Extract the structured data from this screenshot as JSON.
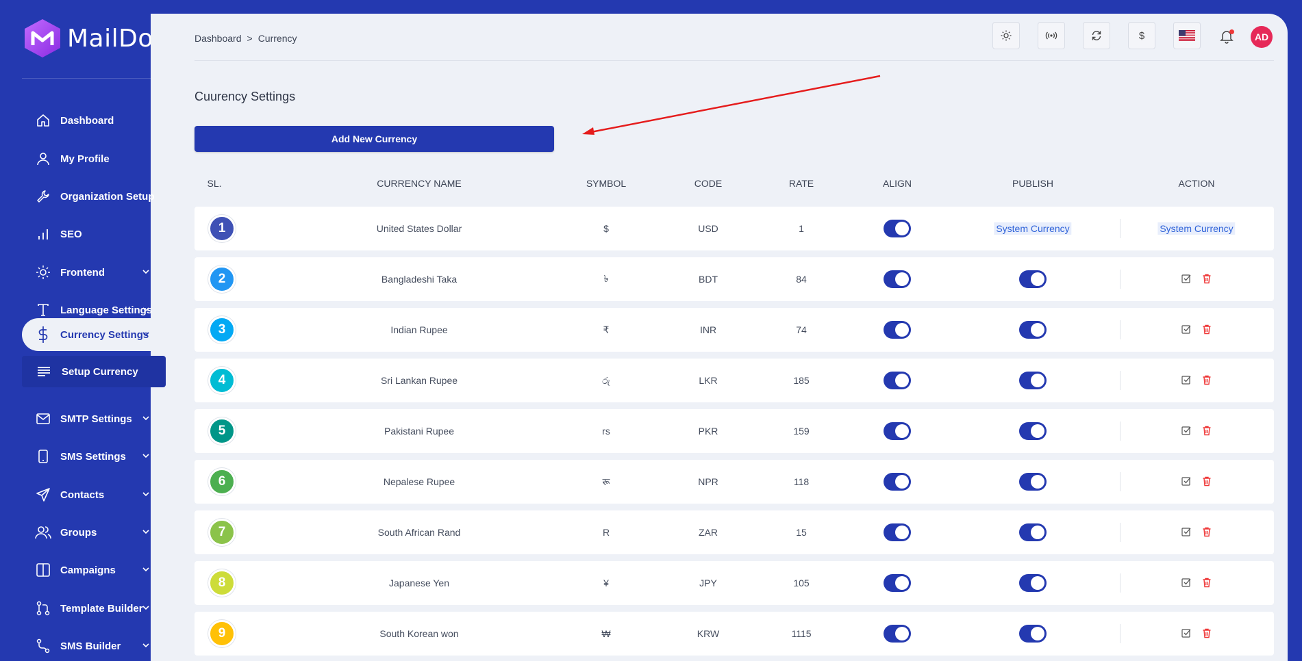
{
  "brand": {
    "name": "MailDoll"
  },
  "sidebar": {
    "items": [
      {
        "label": "Dashboard",
        "icon": "home-icon",
        "has_chevron": false
      },
      {
        "label": "My Profile",
        "icon": "user-icon",
        "has_chevron": false
      },
      {
        "label": "Organization Setup",
        "icon": "wrench-icon",
        "has_chevron": false
      },
      {
        "label": "SEO",
        "icon": "bar-chart-icon",
        "has_chevron": false
      },
      {
        "label": "Frontend",
        "icon": "sun-icon",
        "has_chevron": true
      },
      {
        "label": "Language Settings",
        "icon": "text-icon",
        "has_chevron": true
      },
      {
        "label": "Currency Settings",
        "icon": "dollar-icon",
        "has_chevron": true,
        "active": true
      },
      {
        "label": "SMTP Settings",
        "icon": "mail-icon",
        "has_chevron": true
      },
      {
        "label": "SMS Settings",
        "icon": "phone-icon",
        "has_chevron": true
      },
      {
        "label": "Contacts",
        "icon": "send-icon",
        "has_chevron": true
      },
      {
        "label": "Groups",
        "icon": "users-icon",
        "has_chevron": true
      },
      {
        "label": "Campaigns",
        "icon": "columns-icon",
        "has_chevron": true
      },
      {
        "label": "Template Builder",
        "icon": "git-pull-icon",
        "has_chevron": true
      },
      {
        "label": "SMS Builder",
        "icon": "route-icon",
        "has_chevron": true
      }
    ],
    "sub_item": {
      "label": "Setup Currency",
      "icon": "list-icon"
    }
  },
  "breadcrumb": {
    "root": "Dashboard",
    "separator": ">",
    "current": "Currency"
  },
  "topbar": {
    "buttons": [
      "sun-icon",
      "broadcast-icon",
      "refresh-icon",
      "dollar-icon",
      "us-flag-icon"
    ],
    "currency_symbol": "$",
    "avatar_initials": "AD"
  },
  "page": {
    "title": "Cuurency Settings",
    "add_button": "Add New Currency"
  },
  "table": {
    "headers": {
      "sl": "SL.",
      "name": "CURRENCY NAME",
      "symbol": "SYMBOL",
      "code": "CODE",
      "rate": "RATE",
      "align": "ALIGN",
      "publish": "PUBLISH",
      "action": "ACTION"
    },
    "system_currency_label": "System Currency",
    "rows": [
      {
        "sl": "1",
        "name": "United States Dollar",
        "symbol": "$",
        "code": "USD",
        "rate": "1",
        "align_on": true,
        "system": true,
        "badge_color": "#3f51b5"
      },
      {
        "sl": "2",
        "name": "Bangladeshi Taka",
        "symbol": "৳",
        "code": "BDT",
        "rate": "84",
        "align_on": true,
        "publish_on": true,
        "badge_color": "#2196f3"
      },
      {
        "sl": "3",
        "name": "Indian Rupee",
        "symbol": "₹",
        "code": "INR",
        "rate": "74",
        "align_on": true,
        "publish_on": true,
        "badge_color": "#03a9f4"
      },
      {
        "sl": "4",
        "name": "Sri Lankan Rupee",
        "symbol": "රු",
        "code": "LKR",
        "rate": "185",
        "align_on": true,
        "publish_on": true,
        "badge_color": "#00bcd4"
      },
      {
        "sl": "5",
        "name": "Pakistani Rupee",
        "symbol": "rs",
        "code": "PKR",
        "rate": "159",
        "align_on": true,
        "publish_on": true,
        "badge_color": "#009688"
      },
      {
        "sl": "6",
        "name": "Nepalese Rupee",
        "symbol": "रू",
        "code": "NPR",
        "rate": "118",
        "align_on": true,
        "publish_on": true,
        "badge_color": "#4caf50"
      },
      {
        "sl": "7",
        "name": "South African Rand",
        "symbol": "R",
        "code": "ZAR",
        "rate": "15",
        "align_on": true,
        "publish_on": true,
        "badge_color": "#8bc34a"
      },
      {
        "sl": "8",
        "name": "Japanese Yen",
        "symbol": "¥",
        "code": "JPY",
        "rate": "105",
        "align_on": true,
        "publish_on": true,
        "badge_color": "#cddc39"
      },
      {
        "sl": "9",
        "name": "South Korean won",
        "symbol": "₩",
        "code": "KRW",
        "rate": "1115",
        "align_on": true,
        "publish_on": true,
        "badge_color": "#ffc107"
      }
    ]
  },
  "colors": {
    "primary": "#2439b0",
    "background": "#eef1f7",
    "danger": "#ef3838",
    "annotation_arrow": "#e51c1c"
  }
}
